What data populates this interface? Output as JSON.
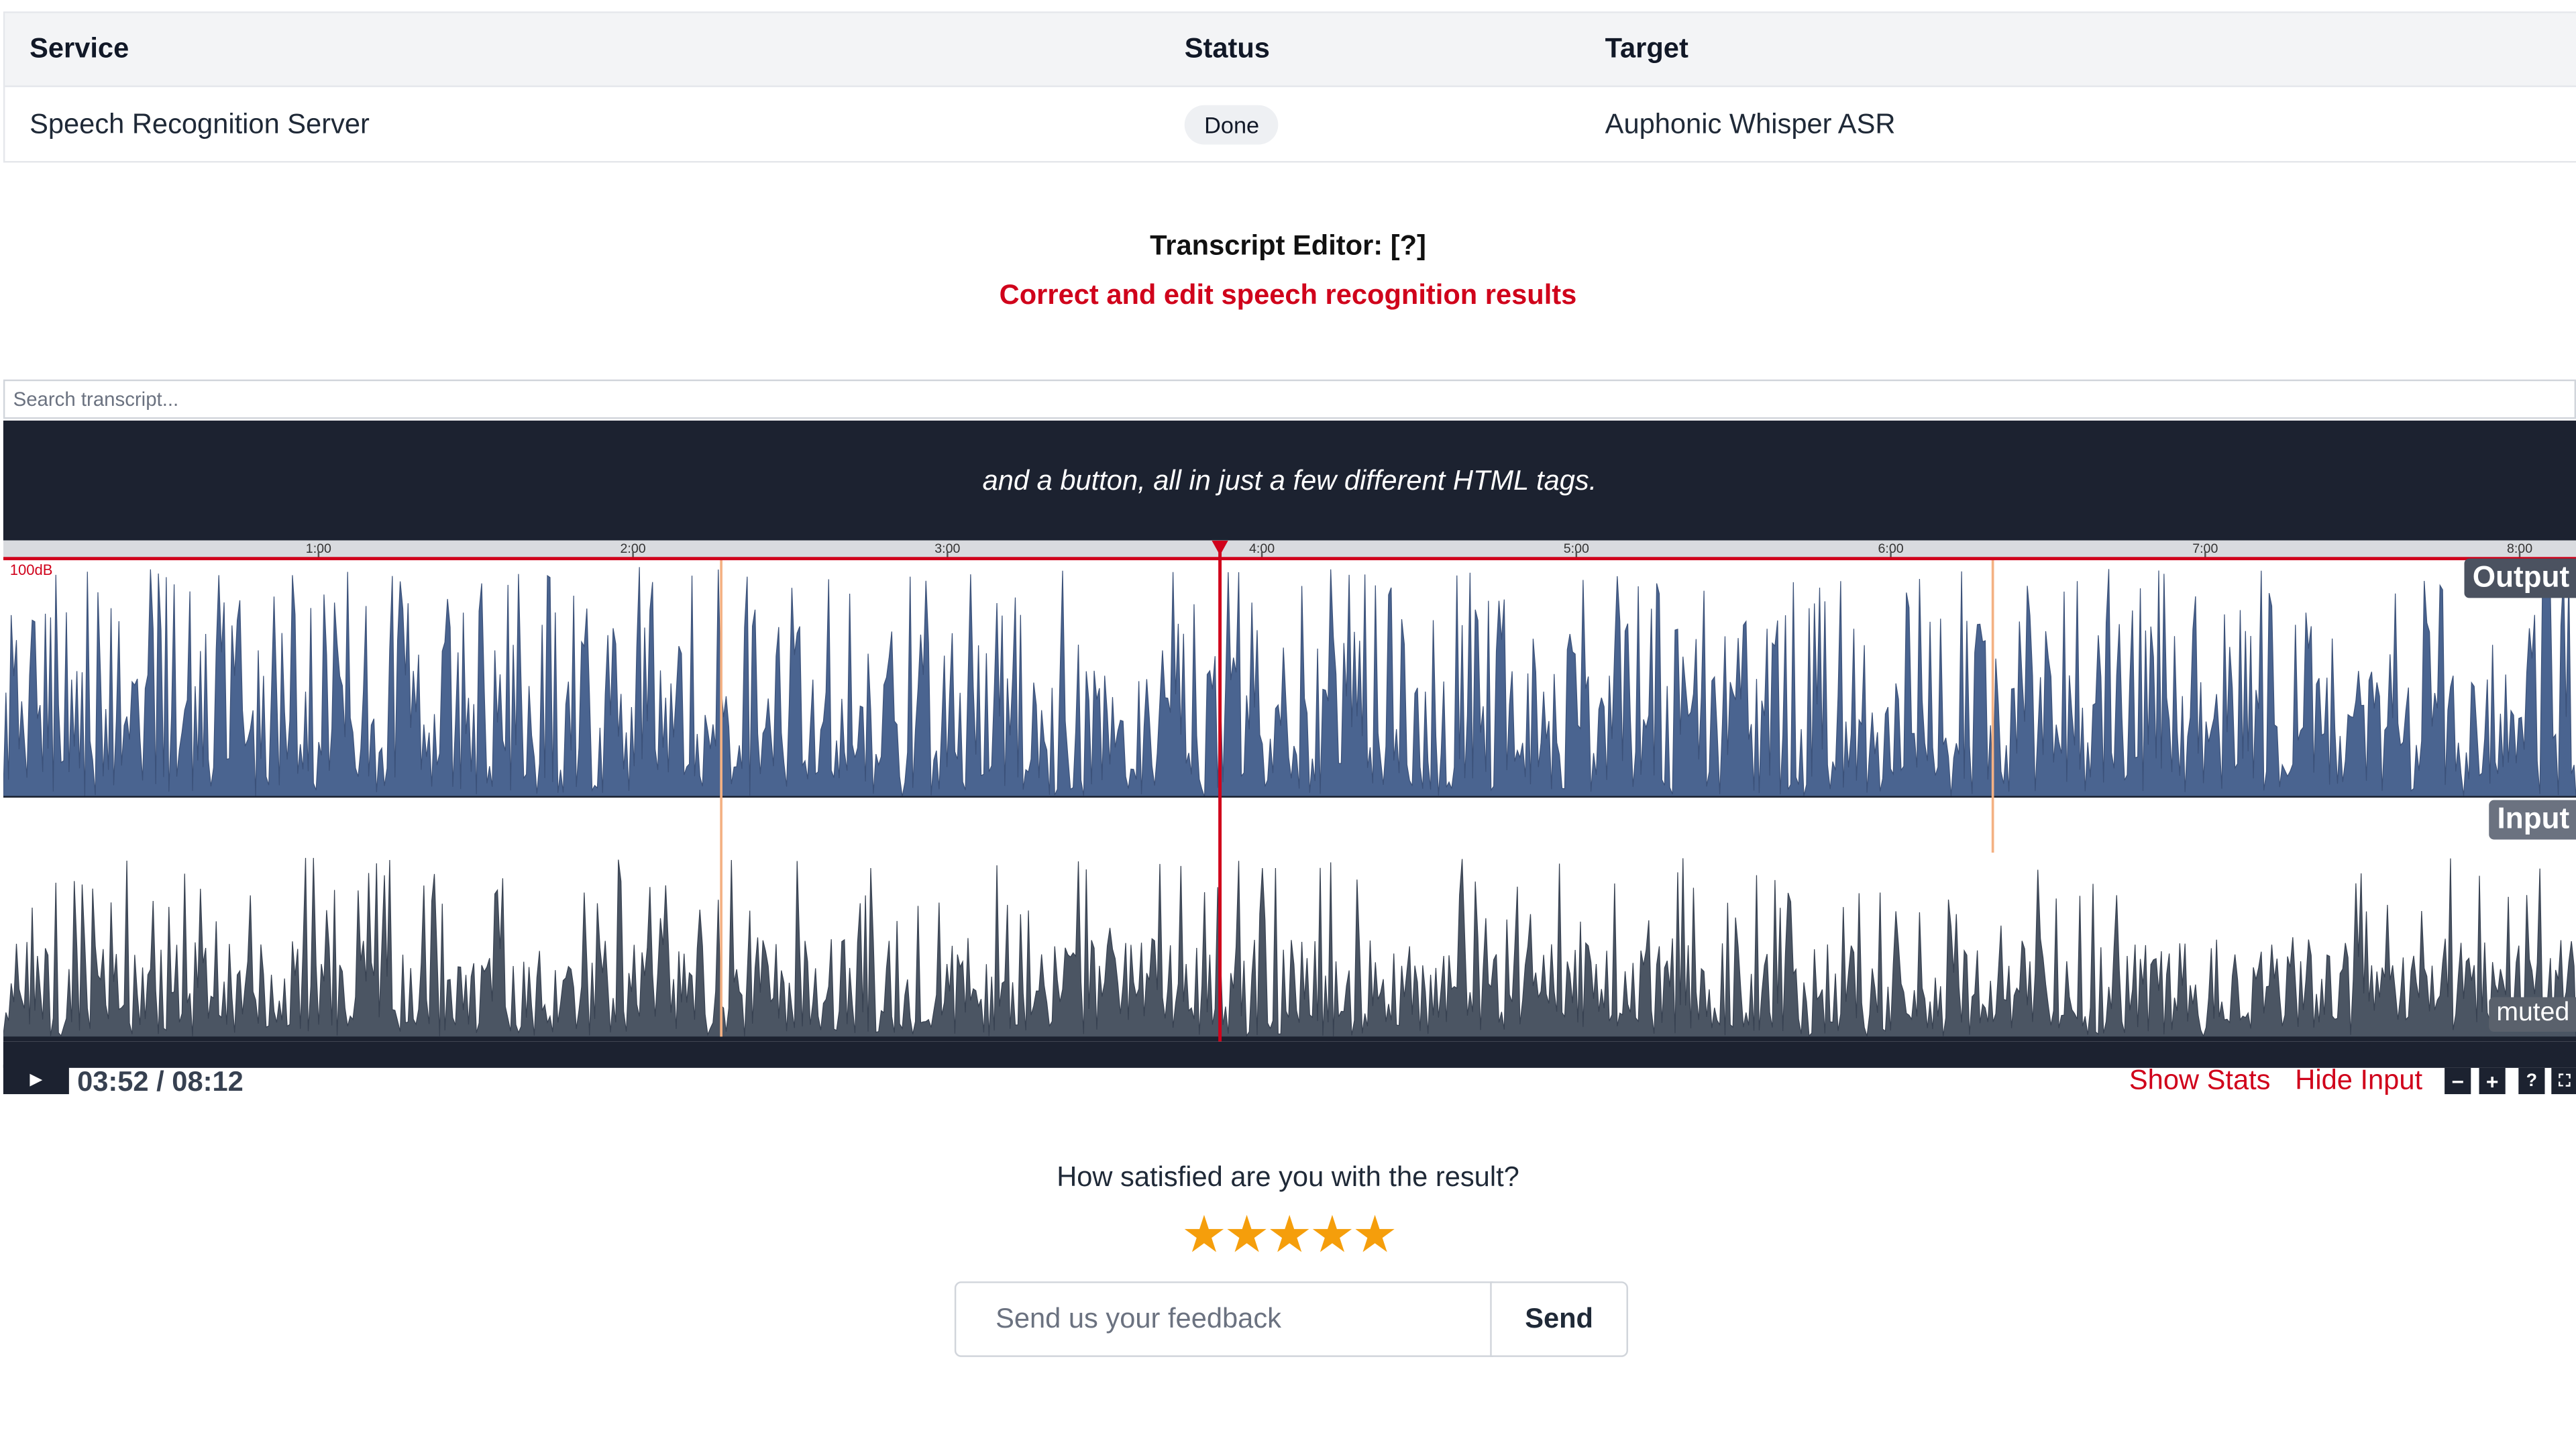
{
  "services_table": {
    "headers": {
      "service": "Service",
      "status": "Status",
      "target": "Target"
    },
    "rows": [
      {
        "service": "Speech Recognition Server",
        "status": "Done",
        "target": "Auphonic Whisper ASR"
      }
    ]
  },
  "editor": {
    "title": "Transcript Editor: [?]",
    "subtitle": "Correct and edit speech recognition results",
    "search": {
      "placeholder": "Search transcript...",
      "value": ""
    },
    "caption": "and a button, all in just a few different HTML tags.",
    "timeline": {
      "ticks": [
        "1:00",
        "2:00",
        "3:00",
        "4:00",
        "5:00",
        "6:00",
        "7:00",
        "8:00"
      ],
      "level_label": "100dB",
      "playhead_seconds": 232,
      "duration_seconds": 492
    },
    "tracks": {
      "output_label": "Output",
      "input_label": "Input",
      "muted_label": "muted"
    },
    "colors": {
      "output_wave": "#4a6490",
      "input_wave": "#4b5563",
      "playhead": "#d0021b",
      "segment_marker": "#f4b183",
      "dark_bar": "#1c2230"
    },
    "controls": {
      "play_icon": "play-icon",
      "time": "03:52 / 08:12",
      "show_stats": "Show Stats",
      "hide_input": "Hide Input",
      "zoom_out": "−",
      "zoom_in": "+",
      "help": "?",
      "fullscreen_icon": "fullscreen-icon"
    }
  },
  "feedback": {
    "question": "How satisfied are you with the result?",
    "rating": 5,
    "rating_max": 5,
    "input": {
      "placeholder": "Send us your feedback",
      "value": ""
    },
    "send_label": "Send"
  }
}
